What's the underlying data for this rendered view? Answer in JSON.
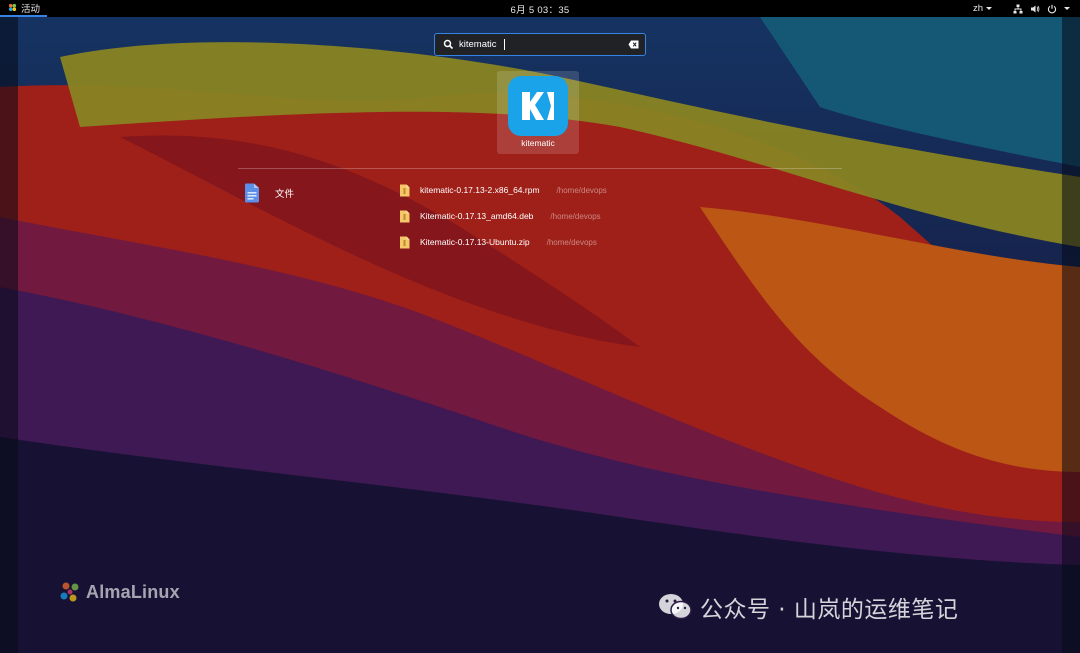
{
  "topbar": {
    "activities_label": "活动",
    "clock": "6月 5  03：35",
    "language": "zh"
  },
  "search": {
    "value": "kitematic",
    "placeholder": ""
  },
  "app_result": {
    "label": "kitematic",
    "icon": "kitematic-app-icon",
    "icon_color": "#1aa3e8"
  },
  "files_provider": {
    "label": "文件",
    "icon": "files-app-icon",
    "results": [
      {
        "name": "kitematic-0.17.13-2.x86_64.rpm",
        "path": "/home/devops"
      },
      {
        "name": "Kitematic-0.17.13_amd64.deb",
        "path": "/home/devops"
      },
      {
        "name": "Kitematic-0.17.13-Ubuntu.zip",
        "path": "/home/devops"
      }
    ]
  },
  "branding": {
    "distro": "AlmaLinux"
  },
  "watermark": {
    "text": "公众号 · 山岚的运维笔记"
  },
  "colors": {
    "accent": "#3584e4",
    "topbar": "#000000"
  }
}
